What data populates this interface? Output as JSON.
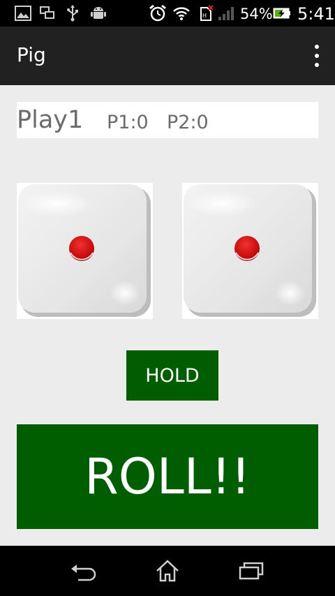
{
  "status_bar": {
    "battery_percent": "54%",
    "time": "5:41",
    "icons": [
      "image-icon",
      "screen-mirror-icon",
      "usb-icon",
      "android-icon",
      "alarm-icon",
      "wifi-icon",
      "sim-no-signal-icon",
      "signal-icon",
      "battery-charging-icon"
    ]
  },
  "action_bar": {
    "title": "Pig",
    "overflow_icon": "more-vert-icon"
  },
  "score": {
    "current_player": "Play1",
    "p1": "P1:0",
    "p2": "P2:0"
  },
  "dice": [
    {
      "value": 1
    },
    {
      "value": 1
    }
  ],
  "buttons": {
    "hold": "HOLD",
    "roll": "ROLL!!"
  },
  "nav_bar": {
    "icons": [
      "back-icon",
      "home-icon",
      "recents-icon"
    ]
  },
  "colors": {
    "button_green": "#005e00",
    "content_bg": "#ececec",
    "action_bar_bg": "#212121",
    "pip_red": "#d01010"
  }
}
